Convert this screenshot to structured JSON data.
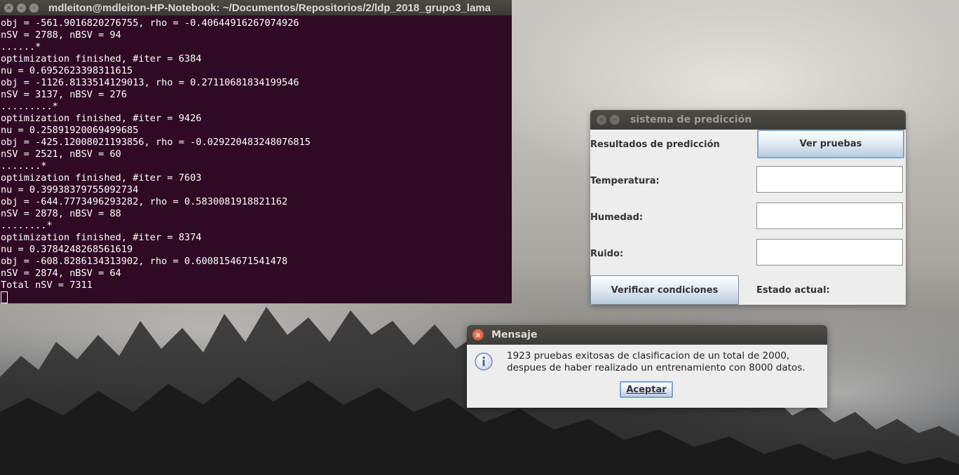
{
  "terminal": {
    "title": "mdleiton@mdleiton-HP-Notebook: ~/Documentos/Repositorios/2/ldp_2018_grupo3_lama",
    "lines": [
      "obj = -561.9016820276755, rho = -0.40644916267074926",
      "nSV = 2788, nBSV = 94",
      "......*",
      "optimization finished, #iter = 6384",
      "nu = 0.6952623398311615",
      "obj = -1126.8133514129013, rho = 0.27110681834199546",
      "nSV = 3137, nBSV = 276",
      ".........*",
      "optimization finished, #iter = 9426",
      "nu = 0.25891920069499685",
      "obj = -425.12008021193856, rho = -0.029220483248076815",
      "nSV = 2521, nBSV = 60",
      ".......*",
      "optimization finished, #iter = 7603",
      "nu = 0.39938379755092734",
      "obj = -644.7773496293282, rho = 0.5830081918821162",
      "nSV = 2878, nBSV = 88",
      "........*",
      "optimization finished, #iter = 8374",
      "nu = 0.3784248268561619",
      "obj = -608.8286134313902, rho = 0.6008154671541478",
      "nSV = 2874, nBSV = 64",
      "Total nSV = 7311"
    ]
  },
  "predict_window": {
    "title": "sistema de predicción",
    "results_label": "Resultados de predicción",
    "view_tests_button": "Ver pruebas",
    "temperature_label": "Temperatura:",
    "temperature_value": "",
    "humidity_label": "Humedad:",
    "humidity_value": "",
    "noise_label": "Ruido:",
    "noise_value": "",
    "verify_button": "Verificar condiciones",
    "status_label": "Estado actual:"
  },
  "message_dialog": {
    "title": "Mensaje",
    "line1": "1923 pruebas exitosas de clasificacion de un total de 2000,",
    "line2": "despues de haber realizado un entrenamiento con 8000 datos.",
    "ok_button": "Aceptar",
    "icon": "info-icon"
  },
  "colors": {
    "terminal_bg": "#300a24",
    "titlebar": "#3c3b37",
    "window_bg": "#ededed",
    "close_button": "#e0582f"
  }
}
